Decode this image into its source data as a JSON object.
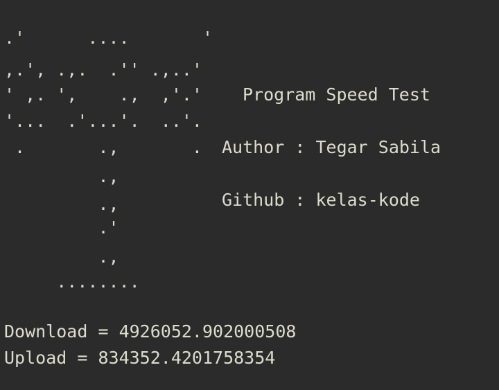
{
  "ascii_art": [
    ".'      ....       '",
    ",.', .,.  .'' .,..'",
    "' ,. ',    .,  ,'.'",
    "'...  .'...'.  ..'.",
    " .       .,       .",
    "         .,",
    "         .,",
    "         .'",
    "         .,",
    "     ........"
  ],
  "info": {
    "title": "Program Speed Test",
    "author": "Author : Tegar Sabila",
    "github": "Github : kelas-kode"
  },
  "results": {
    "download": "Download = 4926052.902000508",
    "upload": "Upload = 834352.4201758354"
  }
}
